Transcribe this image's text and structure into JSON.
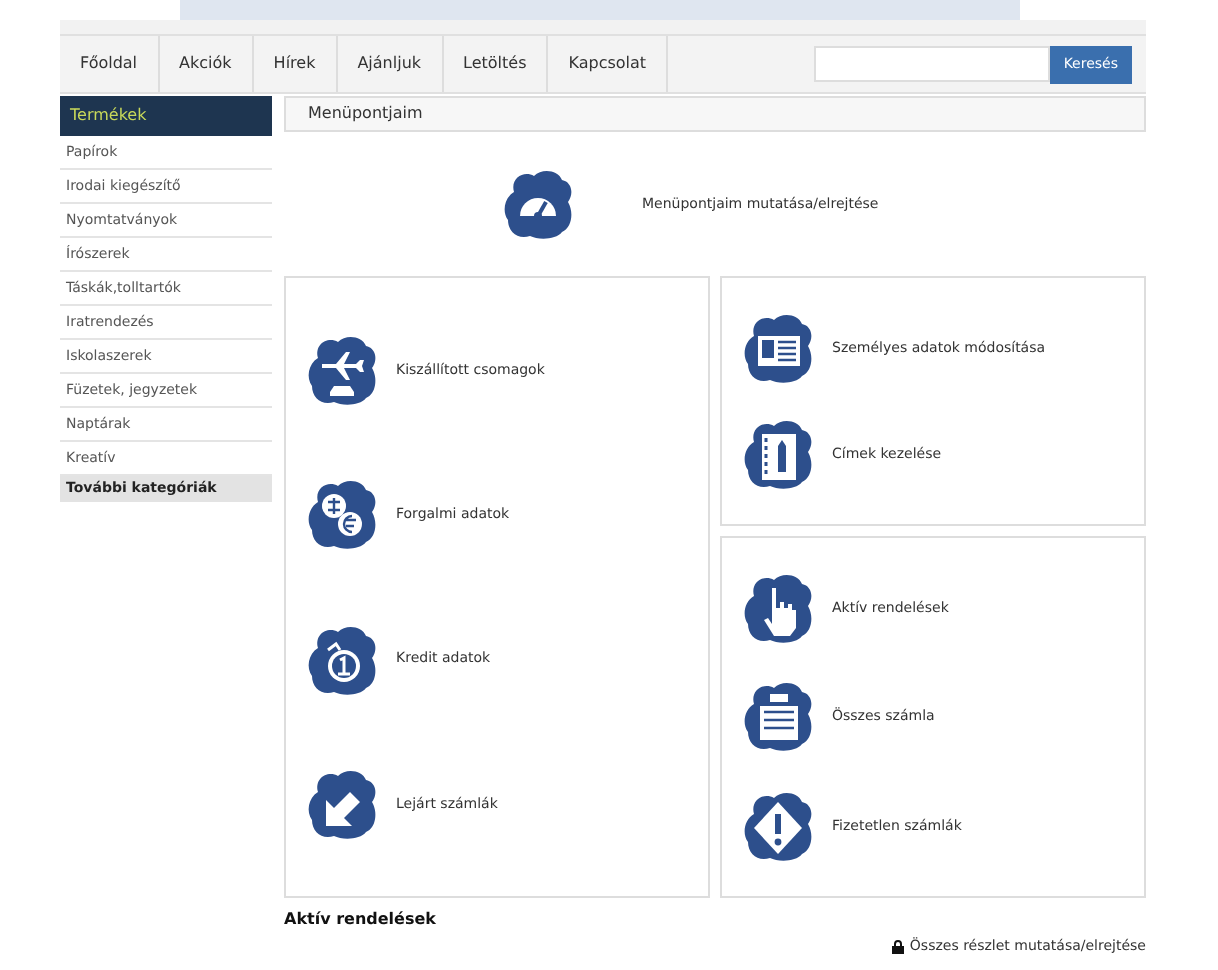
{
  "nav": {
    "items": [
      "Főoldal",
      "Akciók",
      "Hírek",
      "Ajánljuk",
      "Letöltés",
      "Kapcsolat"
    ],
    "search": {
      "button": "Keresés"
    }
  },
  "sidebar": {
    "title": "Termékek",
    "items": [
      {
        "label": "Papírok",
        "kind": "link"
      },
      {
        "label": "Irodai kiegészítő",
        "kind": "link"
      },
      {
        "label": "Nyomtatványok",
        "kind": "link"
      },
      {
        "label": "Írószerek",
        "kind": "link"
      },
      {
        "label": "Táskák,tolltartók",
        "kind": "link"
      },
      {
        "label": "Iratrendezés",
        "kind": "link"
      },
      {
        "label": "Iskolaszerek",
        "kind": "link"
      },
      {
        "label": "Füzetek, jegyzetek",
        "kind": "link"
      },
      {
        "label": "Naptárak",
        "kind": "link"
      },
      {
        "label": "Kreatív",
        "kind": "link"
      },
      {
        "label": "További kategóriák",
        "kind": "more"
      }
    ]
  },
  "content": {
    "title": "Menüpontjaim",
    "toggle": "Menüpontjaim mutatása/elrejtése",
    "panels": [
      {
        "items": [
          "Kiszállított csomagok",
          "Forgalmi adatok",
          "Kredit adatok",
          "Lejárt számlák"
        ]
      },
      {
        "items": [
          "Személyes adatok módosítása",
          "Címek kezelése"
        ]
      },
      {
        "items": [
          "Aktív rendelések",
          "Összes számla",
          "Fizetetlen számlák"
        ]
      }
    ],
    "section_title": "Aktív rendelések",
    "details_toggle": "Összes részlet mutatása/elrejtése"
  }
}
